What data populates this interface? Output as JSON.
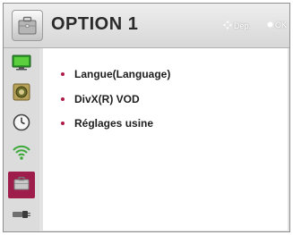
{
  "header": {
    "title": "OPTION 1",
    "hint_move": "Dép.",
    "hint_ok": "OK",
    "icon": "briefcase-icon"
  },
  "sidebar": {
    "items": [
      {
        "icon": "picture-icon",
        "active": false
      },
      {
        "icon": "sound-icon",
        "active": false
      },
      {
        "icon": "clock-icon",
        "active": false
      },
      {
        "icon": "network-icon",
        "active": false
      },
      {
        "icon": "option-icon",
        "active": true
      },
      {
        "icon": "input-icon",
        "active": false
      }
    ]
  },
  "menu": {
    "items": [
      {
        "label": "Langue(Language)"
      },
      {
        "label": "DivX(R) VOD"
      },
      {
        "label": "Réglages usine"
      }
    ]
  },
  "colors": {
    "accent": "#9e1d4a",
    "bullet": "#b01c4a",
    "panel": "#e3e3e3",
    "content_bg": "#ffffff"
  }
}
